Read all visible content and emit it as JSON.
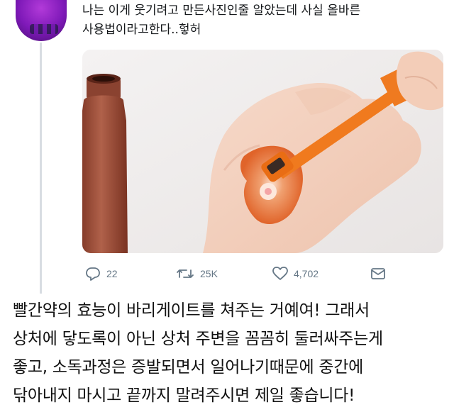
{
  "tweet": {
    "text": "나는 이게 웃기려고 만든사진인줄 알았는데 사실 올바른\n사용법이라고한다..헣허",
    "actions": {
      "replies": "22",
      "retweets": "25K",
      "likes": "4,702"
    },
    "icons": [
      "reply-icon",
      "retweet-icon",
      "like-icon",
      "share-icon"
    ]
  },
  "caption": {
    "text": "빨간약의 효능이 바리게이트를 쳐주는 거예여! 그래서\n상처에 닿도록이 아닌 상처 주변을 꼼꼼히 둘러싸주는게\n좋고, 소독과정은 증발되면서 일어나기때문에 중간에\n닦아내지 마시고 끝까지 말려주시면 제일 좋습니다!"
  },
  "colors": {
    "bottle": "#9b4a36",
    "applicator": "#f07a1e",
    "iodine": "#e0642a",
    "action_gray": "#657786"
  }
}
